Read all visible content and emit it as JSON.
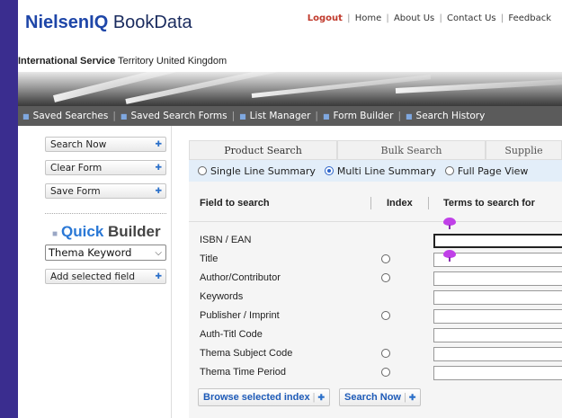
{
  "header": {
    "logo_brand": "NielsenIQ",
    "logo_sub": " BookData",
    "links": [
      "Logout",
      "Home",
      "About Us",
      "Contact Us",
      "Feedback"
    ],
    "territory_bold": "International Service",
    "territory_text": " Territory United Kingdom"
  },
  "nav": {
    "items": [
      "Saved Searches",
      "Saved Search Forms",
      "List Manager",
      "Form Builder",
      "Search History"
    ]
  },
  "sidebar": {
    "buttons": [
      "Search Now",
      "Clear Form",
      "Save Form"
    ],
    "quick_builder_a": "Quick",
    "quick_builder_b": " Builder",
    "select_value": "Thema Keyword",
    "add_field": "Add selected field"
  },
  "tabs": [
    "Product Search",
    "Bulk Search",
    "Supplie"
  ],
  "view_options": {
    "items": [
      "Single Line Summary",
      "Multi Line Summary",
      "Full Page View"
    ],
    "selected": "Multi Line Summary"
  },
  "fields": {
    "headers": {
      "field": "Field to search",
      "index": "Index",
      "terms": "Terms to search for"
    },
    "rows": [
      {
        "label": "ISBN / EAN",
        "index": false
      },
      {
        "label": "Title",
        "index": true
      },
      {
        "label": "Author/Contributor",
        "index": true
      },
      {
        "label": "Keywords",
        "index": false
      },
      {
        "label": "Publisher / Imprint",
        "index": true
      },
      {
        "label": "Auth-Titl Code",
        "index": false
      },
      {
        "label": "Thema Subject Code",
        "index": true
      },
      {
        "label": "Thema Time Period",
        "index": true
      }
    ]
  },
  "actions": {
    "browse": "Browse selected index",
    "search": "Search Now"
  },
  "colors": {
    "accent": "#1e46a8",
    "nav_bg": "#5b5b5b",
    "view_bar": "#e3eef9"
  }
}
